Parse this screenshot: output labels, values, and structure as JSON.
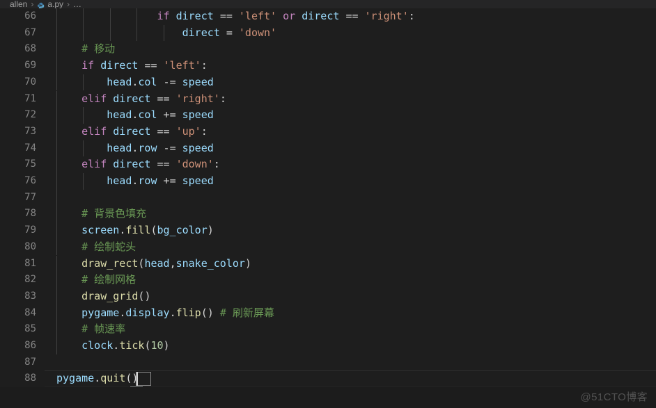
{
  "window": {
    "background": "#1e1e1e",
    "gutter_color": "#858585"
  },
  "breadcrumb": {
    "root": "allen",
    "separator": "›",
    "file": "a.py",
    "tail": "…",
    "file_icon": "python-file-icon"
  },
  "editor": {
    "language": "python",
    "first_visible_line": 66,
    "last_visible_line": 88,
    "cursor_line": 88,
    "cursor_column": 13,
    "theme_colors": {
      "keyword": "#C586C0",
      "variable": "#9CDCFE",
      "string": "#CE9178",
      "comment": "#6A9955",
      "function": "#DCDCAA",
      "number": "#B5CEA8",
      "operator": "#d4d4d4",
      "line_number": "#858585",
      "background": "#1e1e1e",
      "indent_guide": "#404040"
    },
    "lines": [
      {
        "num": "66",
        "indent": 4,
        "code": "if direct == 'left' or direct == 'right':"
      },
      {
        "num": "67",
        "indent": 5,
        "code": "direct = 'down'"
      },
      {
        "num": "68",
        "indent": 1,
        "code": "# 移动"
      },
      {
        "num": "69",
        "indent": 1,
        "code": "if direct == 'left':"
      },
      {
        "num": "70",
        "indent": 2,
        "code": "head.col -= speed"
      },
      {
        "num": "71",
        "indent": 1,
        "code": "elif direct == 'right':"
      },
      {
        "num": "72",
        "indent": 2,
        "code": "head.col += speed"
      },
      {
        "num": "73",
        "indent": 1,
        "code": "elif direct == 'up':"
      },
      {
        "num": "74",
        "indent": 2,
        "code": "head.row -= speed"
      },
      {
        "num": "75",
        "indent": 1,
        "code": "elif direct == 'down':"
      },
      {
        "num": "76",
        "indent": 2,
        "code": "head.row += speed"
      },
      {
        "num": "77",
        "indent": 0,
        "code": ""
      },
      {
        "num": "78",
        "indent": 1,
        "code": "# 背景色填充"
      },
      {
        "num": "79",
        "indent": 1,
        "code": "screen.fill(bg_color)"
      },
      {
        "num": "80",
        "indent": 1,
        "code": "# 绘制蛇头"
      },
      {
        "num": "81",
        "indent": 1,
        "code": "draw_rect(head,snake_color)"
      },
      {
        "num": "82",
        "indent": 1,
        "code": "# 绘制网格"
      },
      {
        "num": "83",
        "indent": 1,
        "code": "draw_grid()"
      },
      {
        "num": "84",
        "indent": 1,
        "code": "pygame.display.flip() # 刷新屏幕"
      },
      {
        "num": "85",
        "indent": 1,
        "code": "# 帧速率"
      },
      {
        "num": "86",
        "indent": 1,
        "code": "clock.tick(10)"
      },
      {
        "num": "87",
        "indent": 0,
        "code": ""
      },
      {
        "num": "88",
        "indent": 0,
        "code": "pygame.quit()"
      }
    ]
  },
  "scrollbar": {
    "orientation": "horizontal",
    "thumb_position_pct": 14
  },
  "watermark": {
    "text": "@51CTO博客"
  }
}
